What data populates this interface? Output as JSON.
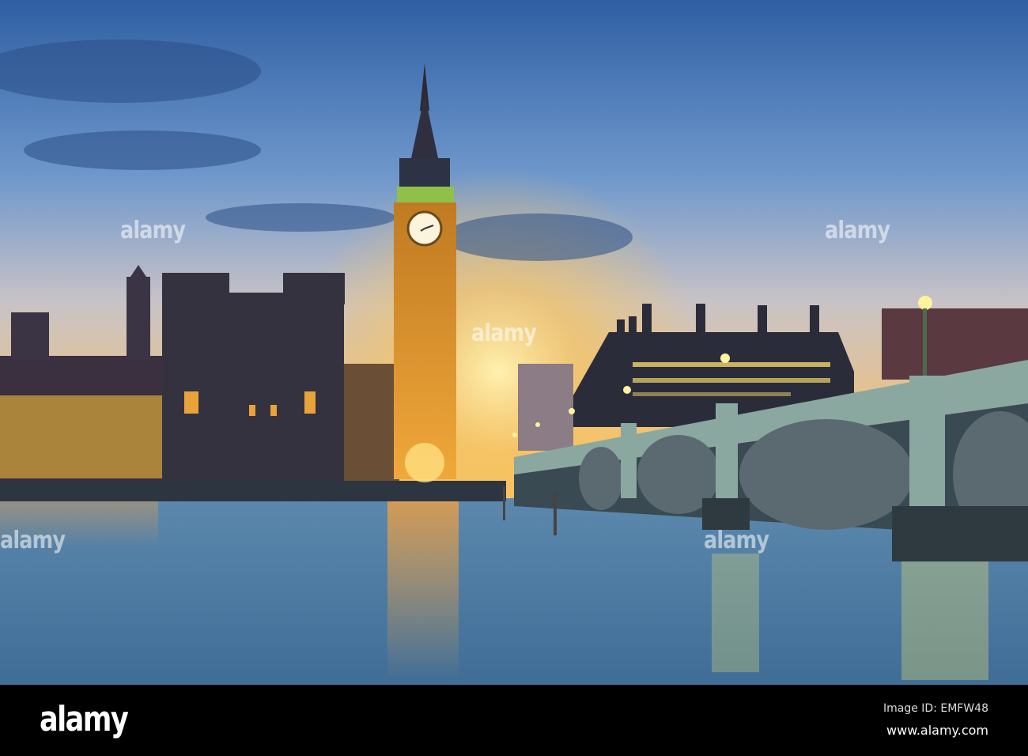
{
  "photo": {
    "subject": "Big Ben and Westminster Bridge at sunset",
    "watermark": "alamy"
  },
  "footer": {
    "logo": "alamy",
    "image_id": "Image ID: EMFW48",
    "url": "www.alamy.com"
  },
  "colors": {
    "sky_top": "#2f5fa3",
    "sky_horizon": "#f7c25a",
    "water": "#4f7fa6",
    "tower_glow": "#e59a2a"
  }
}
